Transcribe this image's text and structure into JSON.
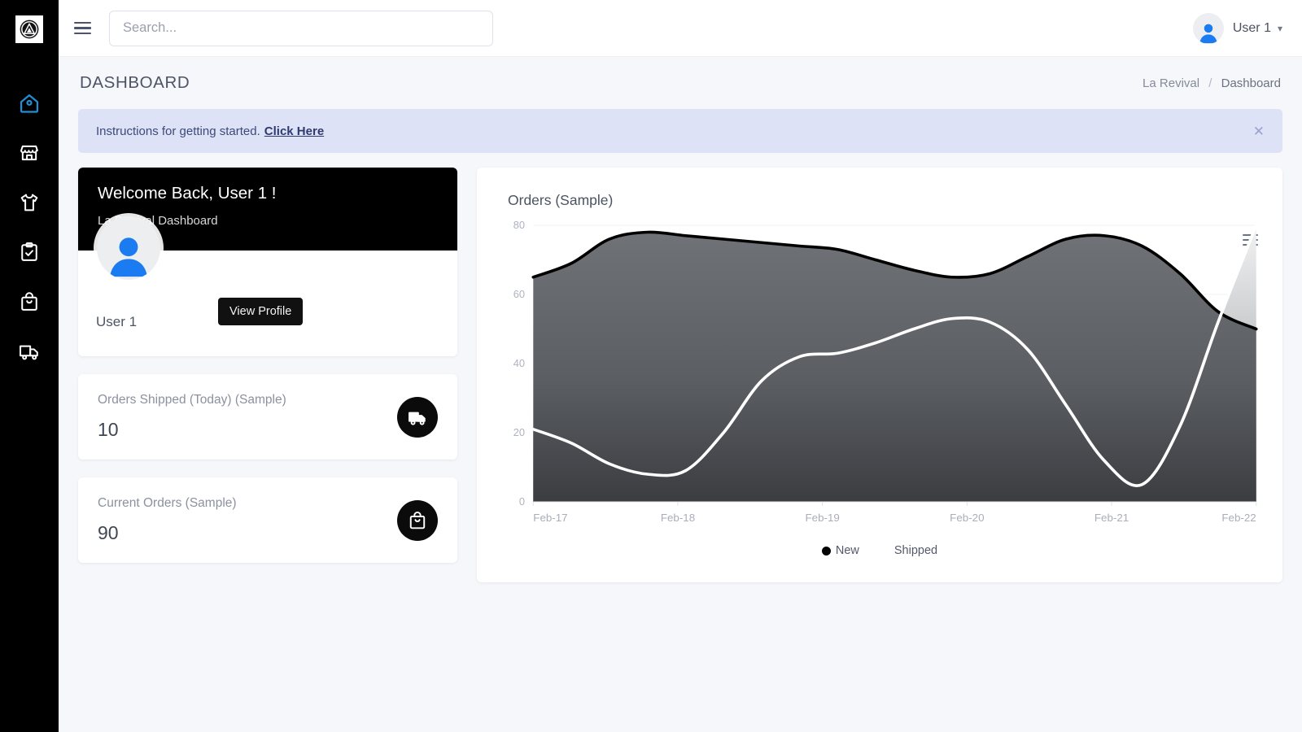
{
  "brand": {
    "logo_icon": "triangle-circle-logo"
  },
  "sidebar": {
    "items": [
      {
        "icon": "home-icon",
        "name": "dashboard",
        "active": true
      },
      {
        "icon": "store-icon",
        "name": "store",
        "active": false
      },
      {
        "icon": "tshirt-icon",
        "name": "products",
        "active": false
      },
      {
        "icon": "clipboard-check-icon",
        "name": "tasks",
        "active": false
      },
      {
        "icon": "shopping-bag-icon",
        "name": "orders",
        "active": false
      },
      {
        "icon": "truck-icon",
        "name": "shipping",
        "active": false
      }
    ],
    "active_color": "#1f8fd6",
    "bg_color": "#000000"
  },
  "topbar": {
    "menu_toggle_icon": "hamburger-icon",
    "search": {
      "value": "",
      "placeholder": "Search..."
    },
    "user": {
      "name": "User 1",
      "avatar_icon": "user-avatar-icon",
      "caret_icon": "chevron-down-icon"
    }
  },
  "page": {
    "title": "DASHBOARD",
    "breadcrumb": {
      "root": "La Revival",
      "separator": "/",
      "current": "Dashboard"
    }
  },
  "banner": {
    "text": "Instructions for getting started.",
    "link_label": "Click Here",
    "close_icon": "close-icon",
    "bg_color": "#dee2f7",
    "text_color": "#3b4a7a"
  },
  "welcome_card": {
    "title": "Welcome Back, User 1 !",
    "subtitle": "La Revival Dashboard",
    "username": "User 1",
    "action_label": "View Profile",
    "avatar_icon": "user-avatar-icon",
    "header_bg": "#000000"
  },
  "stats": [
    {
      "label": "Orders Shipped (Today) (Sample)",
      "value": "10",
      "icon": "truck-icon"
    },
    {
      "label": "Current Orders (Sample)",
      "value": "90",
      "icon": "shopping-bag-icon"
    }
  ],
  "chart_card": {
    "title": "Orders (Sample)",
    "menu_icon": "hamburger-menu-icon"
  },
  "chart_data": {
    "type": "area",
    "title": "Orders (Sample)",
    "xlabel": "",
    "ylabel": "",
    "x": [
      "Feb-17",
      "Feb-18",
      "Feb-19",
      "Feb-20",
      "Feb-21",
      "Feb-22"
    ],
    "ylim": [
      0,
      80
    ],
    "yticks": [
      0,
      20,
      40,
      60,
      80
    ],
    "grid": true,
    "legend_position": "bottom",
    "series": [
      {
        "name": "New",
        "color": "#000000",
        "fill": "gradient-dark-gray",
        "values": [
          65,
          78,
          74,
          65,
          77,
          50
        ],
        "dense": [
          65,
          69,
          76,
          78,
          77,
          76,
          75,
          74,
          73,
          70,
          67,
          65,
          66,
          71,
          76,
          77,
          74,
          66,
          55,
          50
        ]
      },
      {
        "name": "Shipped",
        "color": "#ffffff",
        "fill": "gradient-light-gray",
        "values": [
          21,
          8,
          42,
          53,
          5,
          80
        ],
        "dense": [
          21,
          17,
          11,
          8,
          9,
          20,
          35,
          42,
          43,
          46,
          50,
          53,
          52,
          44,
          28,
          12,
          5,
          22,
          52,
          80
        ]
      }
    ]
  }
}
